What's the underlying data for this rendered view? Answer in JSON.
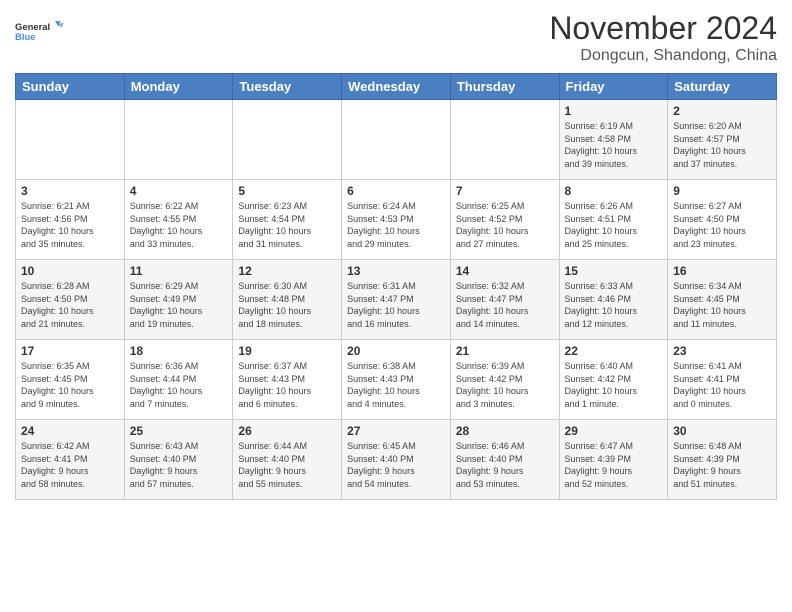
{
  "header": {
    "logo_line1": "General",
    "logo_line2": "Blue",
    "month": "November 2024",
    "location": "Dongcun, Shandong, China"
  },
  "days_of_week": [
    "Sunday",
    "Monday",
    "Tuesday",
    "Wednesday",
    "Thursday",
    "Friday",
    "Saturday"
  ],
  "weeks": [
    [
      {
        "day": "",
        "info": ""
      },
      {
        "day": "",
        "info": ""
      },
      {
        "day": "",
        "info": ""
      },
      {
        "day": "",
        "info": ""
      },
      {
        "day": "",
        "info": ""
      },
      {
        "day": "1",
        "info": "Sunrise: 6:19 AM\nSunset: 4:58 PM\nDaylight: 10 hours\nand 39 minutes."
      },
      {
        "day": "2",
        "info": "Sunrise: 6:20 AM\nSunset: 4:57 PM\nDaylight: 10 hours\nand 37 minutes."
      }
    ],
    [
      {
        "day": "3",
        "info": "Sunrise: 6:21 AM\nSunset: 4:56 PM\nDaylight: 10 hours\nand 35 minutes."
      },
      {
        "day": "4",
        "info": "Sunrise: 6:22 AM\nSunset: 4:55 PM\nDaylight: 10 hours\nand 33 minutes."
      },
      {
        "day": "5",
        "info": "Sunrise: 6:23 AM\nSunset: 4:54 PM\nDaylight: 10 hours\nand 31 minutes."
      },
      {
        "day": "6",
        "info": "Sunrise: 6:24 AM\nSunset: 4:53 PM\nDaylight: 10 hours\nand 29 minutes."
      },
      {
        "day": "7",
        "info": "Sunrise: 6:25 AM\nSunset: 4:52 PM\nDaylight: 10 hours\nand 27 minutes."
      },
      {
        "day": "8",
        "info": "Sunrise: 6:26 AM\nSunset: 4:51 PM\nDaylight: 10 hours\nand 25 minutes."
      },
      {
        "day": "9",
        "info": "Sunrise: 6:27 AM\nSunset: 4:50 PM\nDaylight: 10 hours\nand 23 minutes."
      }
    ],
    [
      {
        "day": "10",
        "info": "Sunrise: 6:28 AM\nSunset: 4:50 PM\nDaylight: 10 hours\nand 21 minutes."
      },
      {
        "day": "11",
        "info": "Sunrise: 6:29 AM\nSunset: 4:49 PM\nDaylight: 10 hours\nand 19 minutes."
      },
      {
        "day": "12",
        "info": "Sunrise: 6:30 AM\nSunset: 4:48 PM\nDaylight: 10 hours\nand 18 minutes."
      },
      {
        "day": "13",
        "info": "Sunrise: 6:31 AM\nSunset: 4:47 PM\nDaylight: 10 hours\nand 16 minutes."
      },
      {
        "day": "14",
        "info": "Sunrise: 6:32 AM\nSunset: 4:47 PM\nDaylight: 10 hours\nand 14 minutes."
      },
      {
        "day": "15",
        "info": "Sunrise: 6:33 AM\nSunset: 4:46 PM\nDaylight: 10 hours\nand 12 minutes."
      },
      {
        "day": "16",
        "info": "Sunrise: 6:34 AM\nSunset: 4:45 PM\nDaylight: 10 hours\nand 11 minutes."
      }
    ],
    [
      {
        "day": "17",
        "info": "Sunrise: 6:35 AM\nSunset: 4:45 PM\nDaylight: 10 hours\nand 9 minutes."
      },
      {
        "day": "18",
        "info": "Sunrise: 6:36 AM\nSunset: 4:44 PM\nDaylight: 10 hours\nand 7 minutes."
      },
      {
        "day": "19",
        "info": "Sunrise: 6:37 AM\nSunset: 4:43 PM\nDaylight: 10 hours\nand 6 minutes."
      },
      {
        "day": "20",
        "info": "Sunrise: 6:38 AM\nSunset: 4:43 PM\nDaylight: 10 hours\nand 4 minutes."
      },
      {
        "day": "21",
        "info": "Sunrise: 6:39 AM\nSunset: 4:42 PM\nDaylight: 10 hours\nand 3 minutes."
      },
      {
        "day": "22",
        "info": "Sunrise: 6:40 AM\nSunset: 4:42 PM\nDaylight: 10 hours\nand 1 minute."
      },
      {
        "day": "23",
        "info": "Sunrise: 6:41 AM\nSunset: 4:41 PM\nDaylight: 10 hours\nand 0 minutes."
      }
    ],
    [
      {
        "day": "24",
        "info": "Sunrise: 6:42 AM\nSunset: 4:41 PM\nDaylight: 9 hours\nand 58 minutes."
      },
      {
        "day": "25",
        "info": "Sunrise: 6:43 AM\nSunset: 4:40 PM\nDaylight: 9 hours\nand 57 minutes."
      },
      {
        "day": "26",
        "info": "Sunrise: 6:44 AM\nSunset: 4:40 PM\nDaylight: 9 hours\nand 55 minutes."
      },
      {
        "day": "27",
        "info": "Sunrise: 6:45 AM\nSunset: 4:40 PM\nDaylight: 9 hours\nand 54 minutes."
      },
      {
        "day": "28",
        "info": "Sunrise: 6:46 AM\nSunset: 4:40 PM\nDaylight: 9 hours\nand 53 minutes."
      },
      {
        "day": "29",
        "info": "Sunrise: 6:47 AM\nSunset: 4:39 PM\nDaylight: 9 hours\nand 52 minutes."
      },
      {
        "day": "30",
        "info": "Sunrise: 6:48 AM\nSunset: 4:39 PM\nDaylight: 9 hours\nand 51 minutes."
      }
    ]
  ]
}
